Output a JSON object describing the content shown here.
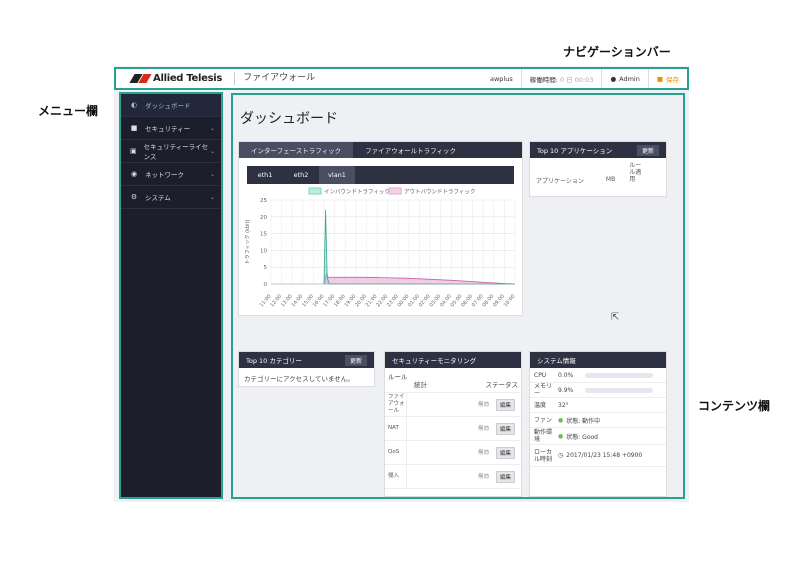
{
  "callouts": {
    "nav": "ナビゲーションバー",
    "menu": "メニュー欄",
    "content": "コンテンツ欄"
  },
  "header": {
    "logo": "Allied Telesis",
    "title": "ファイアウォール",
    "host": "awplus",
    "uptime_label": "稼働時間:",
    "uptime_value": "0 日 00:03",
    "user": "Admin",
    "save": "保存"
  },
  "sidebar": {
    "items": [
      {
        "label": "ダッシュボード",
        "icon": "gauge-icon"
      },
      {
        "label": "セキュリティー",
        "icon": "lock-icon"
      },
      {
        "label": "セキュリティーライセンス",
        "icon": "license-icon"
      },
      {
        "label": "ネットワーク",
        "icon": "globe-icon"
      },
      {
        "label": "システム",
        "icon": "gear-icon"
      }
    ]
  },
  "main": {
    "page_title": "ダッシュボード",
    "traffic": {
      "tabs": [
        "インターフェーストラフィック",
        "ファイアウォールトラフィック"
      ],
      "subtabs": [
        "eth1",
        "eth2",
        "vlan1"
      ]
    },
    "apps": {
      "title": "Top 10 アプリケーション",
      "refresh": "更新",
      "cols": [
        "アプリケーション",
        "MB",
        "ルール適用"
      ]
    },
    "categories": {
      "title": "Top 10 カテゴリー",
      "refresh": "更新",
      "empty": "カテゴリーにアクセスしていません。"
    },
    "security": {
      "title": "セキュリティーモニタリング",
      "cols": [
        "ルール",
        "統計",
        "ステータス"
      ],
      "rows": [
        {
          "name": "ファイアウォール",
          "status": "無効",
          "btn": "編集"
        },
        {
          "name": "NAT",
          "status": "無効",
          "btn": "編集"
        },
        {
          "name": "QoS",
          "status": "無効",
          "btn": "編集"
        },
        {
          "name": "侵入",
          "status": "無効",
          "btn": "編集"
        }
      ]
    },
    "system": {
      "title": "システム情報",
      "rows": [
        {
          "label": "CPU",
          "value": "0.0%"
        },
        {
          "label": "メモリー",
          "value": "9.9%"
        },
        {
          "label": "温度",
          "value": "32°"
        },
        {
          "label": "ファン",
          "value": "状態: 動作中"
        },
        {
          "label": "動作環境",
          "value": "状態: Good"
        },
        {
          "label": "ローカル時刻",
          "value": "2017/01/23 15:48 +0900"
        }
      ],
      "cpu_fraction": 0.0,
      "mem_fraction": 0.099
    }
  },
  "chart_data": {
    "type": "area",
    "ylabel": "トラフィック (kbit)",
    "ylim": [
      0,
      25
    ],
    "yticks": [
      0,
      5,
      10,
      15,
      20,
      25
    ],
    "legend": [
      "インバウンドトラフィック",
      "アウトバウンドトラフィック"
    ],
    "x": [
      "11:00",
      "12:00",
      "13:00",
      "14:00",
      "15:00",
      "16:00",
      "17:00",
      "18:00",
      "19:00",
      "20:00",
      "21:00",
      "22:00",
      "23:00",
      "00:00",
      "01:00",
      "02:00",
      "03:00",
      "04:00",
      "05:00",
      "06:00",
      "07:00",
      "08:00",
      "09:00",
      "10:00"
    ],
    "series": [
      {
        "name": "インバウンドトラフィック",
        "color": "#7fd6c6",
        "points": [
          [
            5.0,
            0
          ],
          [
            5.15,
            22
          ],
          [
            5.3,
            2
          ],
          [
            5.5,
            0
          ],
          [
            23,
            0
          ]
        ]
      },
      {
        "name": "アウトバウンドトラフィック",
        "color": "#e5a6d0",
        "points": [
          [
            5.0,
            0
          ],
          [
            5.2,
            3
          ],
          [
            5.4,
            2
          ],
          [
            9,
            2
          ],
          [
            13,
            1.7
          ],
          [
            17,
            1.1
          ],
          [
            20,
            0.5
          ],
          [
            22,
            0.15
          ],
          [
            23,
            0
          ]
        ]
      }
    ]
  }
}
